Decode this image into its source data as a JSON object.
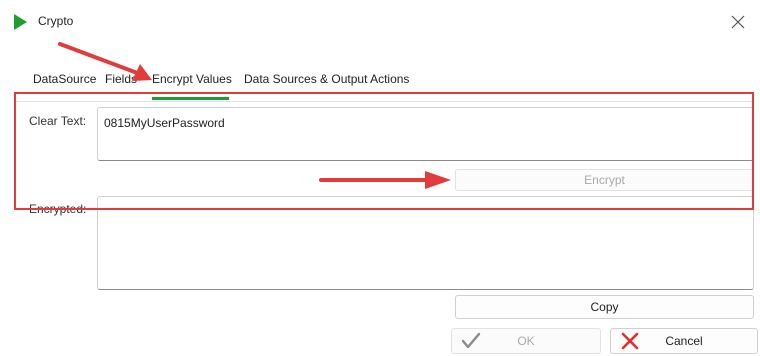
{
  "window": {
    "title": "Crypto",
    "app_icon": "play-triangle-icon",
    "accent_color": "#1e9e2f"
  },
  "tabs": [
    {
      "label": "DataSource",
      "active": false
    },
    {
      "label": "Fields",
      "active": false
    },
    {
      "label": "Encrypt Values",
      "active": true
    },
    {
      "label": "Data Sources & Output Actions",
      "active": false
    }
  ],
  "form": {
    "clear_text_label": "Clear Text:",
    "clear_text_value": "0815MyUserPassword",
    "encrypt_label": "Encrypt",
    "encrypted_label": "Encrypted:",
    "encrypted_value": "",
    "copy_label": "Copy"
  },
  "footer": {
    "ok_label": "OK",
    "cancel_label": "Cancel"
  },
  "annotations": {
    "highlight_color": "#e23b3b"
  }
}
